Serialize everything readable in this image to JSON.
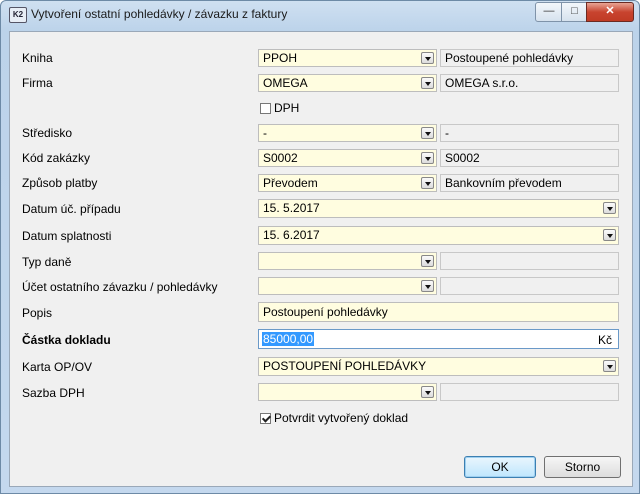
{
  "window": {
    "title": "Vytvoření ostatní pohledávky / závazku z faktury",
    "app_icon_text": "K2",
    "minimize": "—",
    "maximize": "□",
    "close": "✕"
  },
  "form": {
    "kniha": {
      "label": "Kniha",
      "value": "PPOH",
      "desc": "Postoupené pohledávky"
    },
    "firma": {
      "label": "Firma",
      "value": "OMEGA",
      "desc": "OMEGA s.r.o."
    },
    "dph": {
      "label": "DPH",
      "checked": false
    },
    "stredisko": {
      "label": "Středisko",
      "value": "-",
      "desc": "-"
    },
    "kod_zakazky": {
      "label": "Kód zakázky",
      "value": "S0002",
      "desc": "S0002"
    },
    "zpusob_platby": {
      "label": "Způsob platby",
      "value": "Převodem",
      "desc": "Bankovním převodem"
    },
    "datum_uc_pripadu": {
      "label": "Datum úč. případu",
      "value": "15. 5.2017"
    },
    "datum_splatnosti": {
      "label": "Datum splatnosti",
      "value": "15. 6.2017"
    },
    "typ_dane": {
      "label": "Typ daně",
      "value": "",
      "desc": ""
    },
    "ucet": {
      "label": "Účet ostatního závazku / pohledávky",
      "value": "",
      "desc": ""
    },
    "popis": {
      "label": "Popis",
      "value": "Postoupení pohledávky"
    },
    "castka": {
      "label": "Částka dokladu",
      "value": "85000,00",
      "currency": "Kč"
    },
    "karta": {
      "label": "Karta OP/OV",
      "value": "POSTOUPENÍ POHLEDÁVKY"
    },
    "sazba_dph": {
      "label": "Sazba DPH",
      "value": "",
      "desc": ""
    },
    "potvrdit": {
      "label": "Potvrdit vytvořený doklad",
      "checked": true
    }
  },
  "buttons": {
    "ok": "OK",
    "cancel": "Storno"
  }
}
